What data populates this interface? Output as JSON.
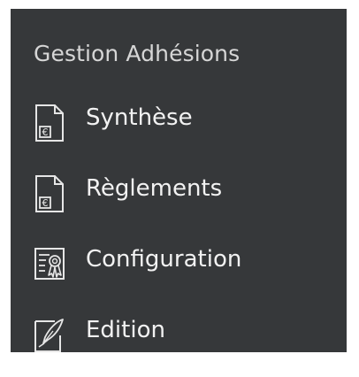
{
  "sidebar": {
    "section_title": "Gestion Adhésions",
    "items": [
      {
        "label": "Synthèse",
        "icon": "euro-document-icon"
      },
      {
        "label": "Règlements",
        "icon": "euro-document-icon"
      },
      {
        "label": "Configuration",
        "icon": "certificate-icon"
      },
      {
        "label": "Edition",
        "icon": "edit-pen-icon"
      }
    ]
  },
  "colors": {
    "panel_background": "#36383a",
    "text_primary": "#f2f2f2",
    "text_secondary": "#d6d6d6",
    "icon_stroke": "#e6e6e6"
  }
}
